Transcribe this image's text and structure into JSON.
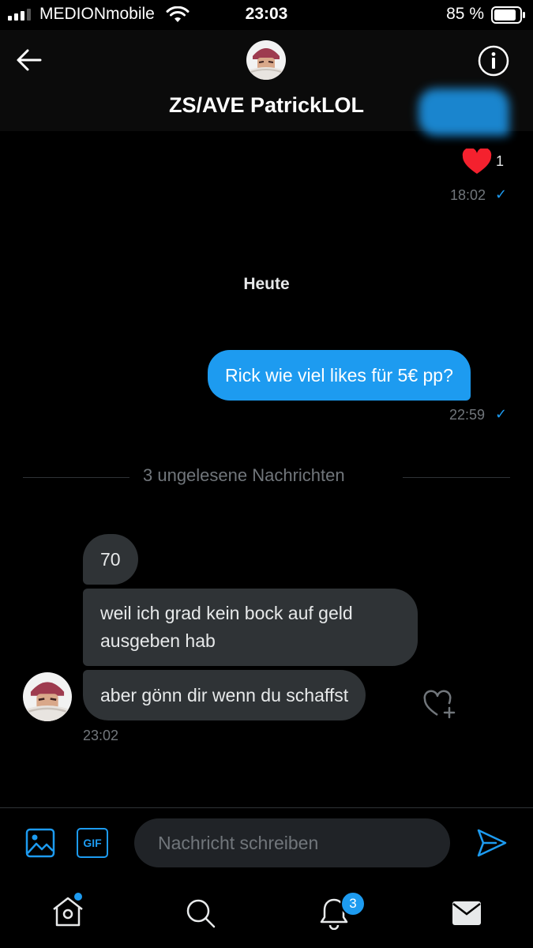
{
  "status_bar": {
    "carrier": "MEDIONmobile",
    "time": "23:03",
    "battery": "85 %"
  },
  "header": {
    "title": "ZS/AVE PatrickLOL",
    "back_icon": "arrow-left-icon",
    "info_icon": "info-circle-icon"
  },
  "earlier_message": {
    "reaction_count": "1",
    "time": "18:02"
  },
  "date_separator": "Heute",
  "sent_message": {
    "text": "Rick wie viel likes für 5€ pp?",
    "time": "22:59"
  },
  "unread_divider": "3 ungelesene Nachrichten",
  "received_messages": [
    {
      "text": "70"
    },
    {
      "text": "weil ich grad kein bock auf geld ausgeben hab"
    },
    {
      "text": "aber gönn dir wenn du schaffst"
    }
  ],
  "received_time": "23:02",
  "composer": {
    "placeholder": "Nachricht schreiben",
    "gif_label": "GIF"
  },
  "bottom_nav": {
    "notifications_badge": "3"
  },
  "colors": {
    "accent": "#1d9bf0",
    "bubble_in": "#2f3336",
    "heart": "#f91880"
  }
}
